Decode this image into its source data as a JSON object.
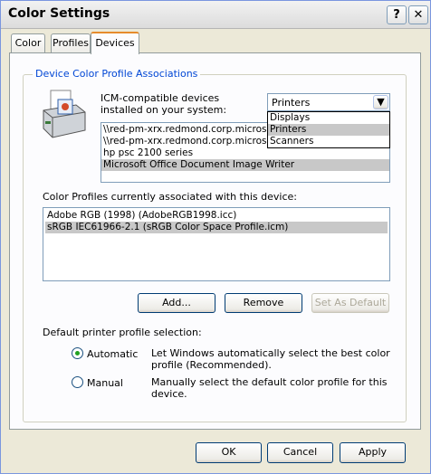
{
  "window": {
    "title": "Color Settings",
    "help_glyph": "?",
    "close_glyph": "✕"
  },
  "tabs": [
    {
      "label": "Color",
      "active": false
    },
    {
      "label": "Profiles",
      "active": false
    },
    {
      "label": "Devices",
      "active": true
    }
  ],
  "group": {
    "legend": "Device Color Profile Associations"
  },
  "device_icon": "printer-icon",
  "devices_label": "ICM-compatible devices installed on your system:",
  "device_type": {
    "selected": "Printers",
    "options": [
      "Displays",
      "Printers",
      "Scanners"
    ],
    "highlighted": "Printers"
  },
  "devices": [
    {
      "name": "\\\\red-pm-xrx.redmond.corp.microsoft.c",
      "selected": false
    },
    {
      "name": "\\\\red-pm-xrx.redmond.corp.microsoft.c",
      "selected": false
    },
    {
      "name": "hp psc 2100 series",
      "selected": false
    },
    {
      "name": "Microsoft Office Document Image Writer",
      "selected": true
    }
  ],
  "profiles_label": "Color Profiles currently associated with this device:",
  "profiles": [
    {
      "name": "Adobe RGB (1998) (AdobeRGB1998.icc)",
      "selected": false
    },
    {
      "name": "sRGB IEC61966-2.1 (sRGB Color Space Profile.icm)",
      "selected": true
    }
  ],
  "buttons": {
    "add": "Add...",
    "remove": "Remove",
    "set_default": "Set As Default"
  },
  "default_selection": {
    "label": "Default printer profile selection:",
    "automatic": {
      "label": "Automatic",
      "desc": "Let Windows automatically select the best color profile (Recommended).",
      "checked": true
    },
    "manual": {
      "label": "Manual",
      "desc": "Manually select the default color profile for this device.",
      "checked": false
    }
  },
  "footer": {
    "ok": "OK",
    "cancel": "Cancel",
    "apply": "Apply"
  }
}
